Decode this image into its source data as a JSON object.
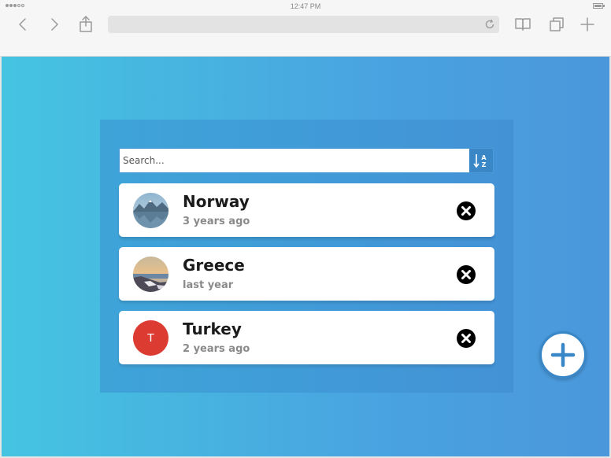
{
  "statusbar": {
    "time": "12:47 PM"
  },
  "browser": {
    "icons": [
      "back-arrow-icon",
      "forward-arrow-icon",
      "share-icon",
      "reload-icon",
      "bookmarks-icon",
      "tabs-icon",
      "new-tab-icon"
    ]
  },
  "search": {
    "placeholder": "Search...",
    "value": ""
  },
  "sort": {
    "icon": "sort-alpha-icon",
    "label_a": "A",
    "label_z": "Z"
  },
  "items": [
    {
      "title": "Norway",
      "subtitle": "3 years ago",
      "avatar": "photo"
    },
    {
      "title": "Greece",
      "subtitle": "last year",
      "avatar": "photo"
    },
    {
      "title": "Turkey",
      "subtitle": "2 years ago",
      "avatar": "letter",
      "letter": "T",
      "avatar_color": "#db3b31"
    }
  ],
  "colors": {
    "accent": "#3a87c7",
    "remove": "#000000",
    "page_gradient_start": "#45c4e1",
    "page_gradient_end": "#4a97db"
  },
  "fab": {
    "icon": "plus-icon"
  }
}
